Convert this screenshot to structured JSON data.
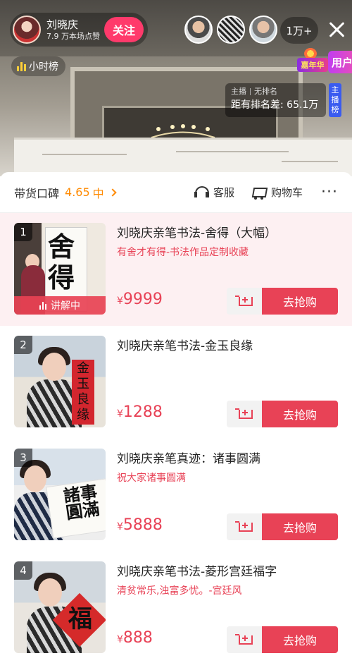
{
  "host": {
    "name": "刘晓庆",
    "likes": "7.9 万本场点赞",
    "follow_label": "关注"
  },
  "viewers": {
    "count_label": "1万+"
  },
  "hour_rank": {
    "label": "小时榜"
  },
  "promo": {
    "carnival_label": "嘉年华",
    "user_tab_label": "用户"
  },
  "rank": {
    "role": "主播",
    "status": "无排名",
    "gap_text": "距有排名差: 65.1万",
    "tab_label": "主播榜"
  },
  "sheet": {
    "reputation_label": "带货口碑",
    "reputation_score": "4.65",
    "reputation_level": "中",
    "service_label": "客服",
    "cart_label": "购物车",
    "more_label": "···"
  },
  "products": [
    {
      "index": "1",
      "title": "刘晓庆亲笔书法-舍得（大幅）",
      "subtitle": "有舍才有得-书法作品定制收藏",
      "currency": "¥",
      "price": "9999",
      "status": "讲解中",
      "buy_label": "去抢购",
      "art_text": [
        "舍",
        "得"
      ]
    },
    {
      "index": "2",
      "title": "刘晓庆亲笔书法-金玉良缘",
      "subtitle": "",
      "currency": "¥",
      "price": "1288",
      "buy_label": "去抢购",
      "art_text": [
        "金",
        "玉",
        "良",
        "缘"
      ]
    },
    {
      "index": "3",
      "title": "刘晓庆亲笔真迹：诸事圆满",
      "subtitle": "祝大家诸事圆满",
      "currency": "¥",
      "price": "5888",
      "buy_label": "去抢购",
      "art_text": [
        "諸事",
        "圓滿"
      ]
    },
    {
      "index": "4",
      "title": "刘晓庆亲笔书法-菱形宫廷福字",
      "subtitle": "清贫常乐,浊富多忧。-宫廷风",
      "currency": "¥",
      "price": "888",
      "buy_label": "去抢购",
      "art_text": [
        "福"
      ]
    }
  ],
  "colors": {
    "accent": "#e84256",
    "follow": "#ff3a6b",
    "reputation": "#ff8a00",
    "active_row_bg": "#fdf0f2"
  }
}
